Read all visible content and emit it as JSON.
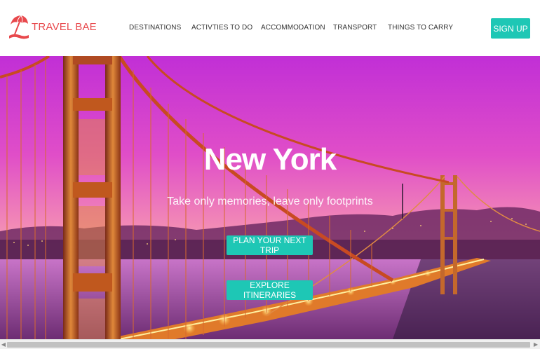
{
  "brand": {
    "name": "TRAVEL BAE",
    "color": "#e8484c",
    "icon": "beach-umbrella-icon"
  },
  "nav": {
    "items": [
      {
        "label": "DESTINATIONS"
      },
      {
        "label": "ACTIVTIES TO DO"
      },
      {
        "label": "ACCOMMODATION"
      },
      {
        "label": "TRANSPORT"
      },
      {
        "label": "THINGS TO CARRY"
      }
    ],
    "signup_label": "SIGN UP"
  },
  "hero": {
    "title": "New York",
    "subtitle": "Take only memories, leave only footprints",
    "plan_label": "PLAN YOUR NEXT TRIP",
    "explore_label": "EXPLORE ITINERARIES",
    "image": "golden-gate-bridge-sunset"
  },
  "colors": {
    "accent": "#1ec7b5",
    "sky_top": "#d23be0",
    "sky_bottom": "#f07fb0",
    "bridge": "#c8502a"
  },
  "scrollbar": {
    "left_arrow": "◀",
    "right_arrow": "▶"
  }
}
